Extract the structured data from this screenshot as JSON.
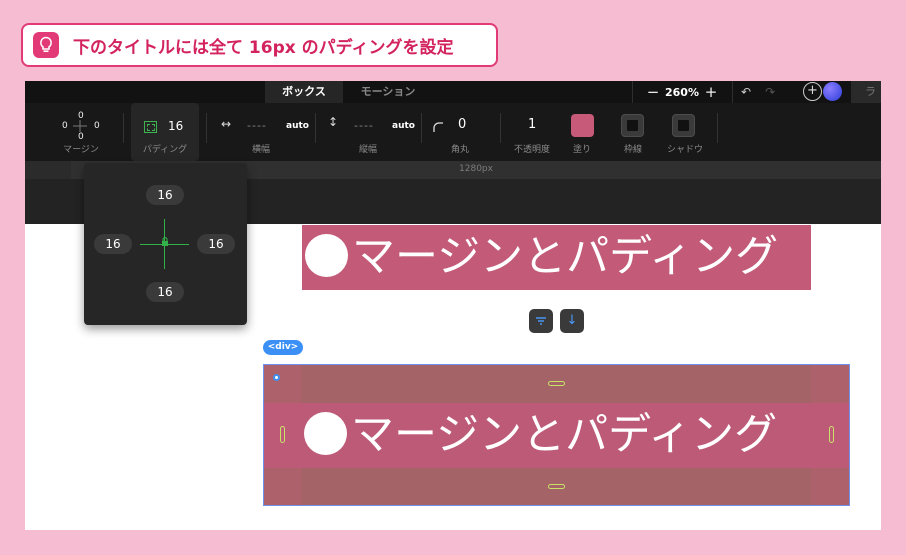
{
  "tip": {
    "icon": "lightbulb-icon",
    "text": "下のタイトルには全て 16px のパディングを設定"
  },
  "topbar": {
    "tabs": [
      {
        "label": "ボックス",
        "active": true
      },
      {
        "label": "モーション",
        "active": false
      }
    ],
    "zoom": {
      "minus": "−",
      "value": "260%",
      "plus": "+"
    },
    "right_tab": "ラ"
  },
  "toolbar": {
    "margin": {
      "label": "マージン",
      "top": "0",
      "right": "0",
      "bottom": "0",
      "left": "0"
    },
    "padding": {
      "label": "パディング",
      "value": "16"
    },
    "width": {
      "label": "横幅",
      "dashes": "----",
      "mode": "auto"
    },
    "height": {
      "label": "縦幅",
      "dashes": "----",
      "mode": "auto"
    },
    "radius": {
      "label": "角丸",
      "value": "0"
    },
    "opacity": {
      "label": "不透明度",
      "value": "1"
    },
    "fill": {
      "label": "塗り",
      "color": "#c65a78"
    },
    "border": {
      "label": "枠線"
    },
    "shadow": {
      "label": "シャドウ"
    }
  },
  "ruler": {
    "text": "1280px"
  },
  "padding_popover": {
    "top": "16",
    "left": "16",
    "right": "16",
    "bottom": "16",
    "linked": true
  },
  "canvas": {
    "heading_top": "マージンとパディング",
    "heading_selected": "マージンとパディング",
    "selection_tag": "<div>",
    "accent": "#c25a78"
  }
}
